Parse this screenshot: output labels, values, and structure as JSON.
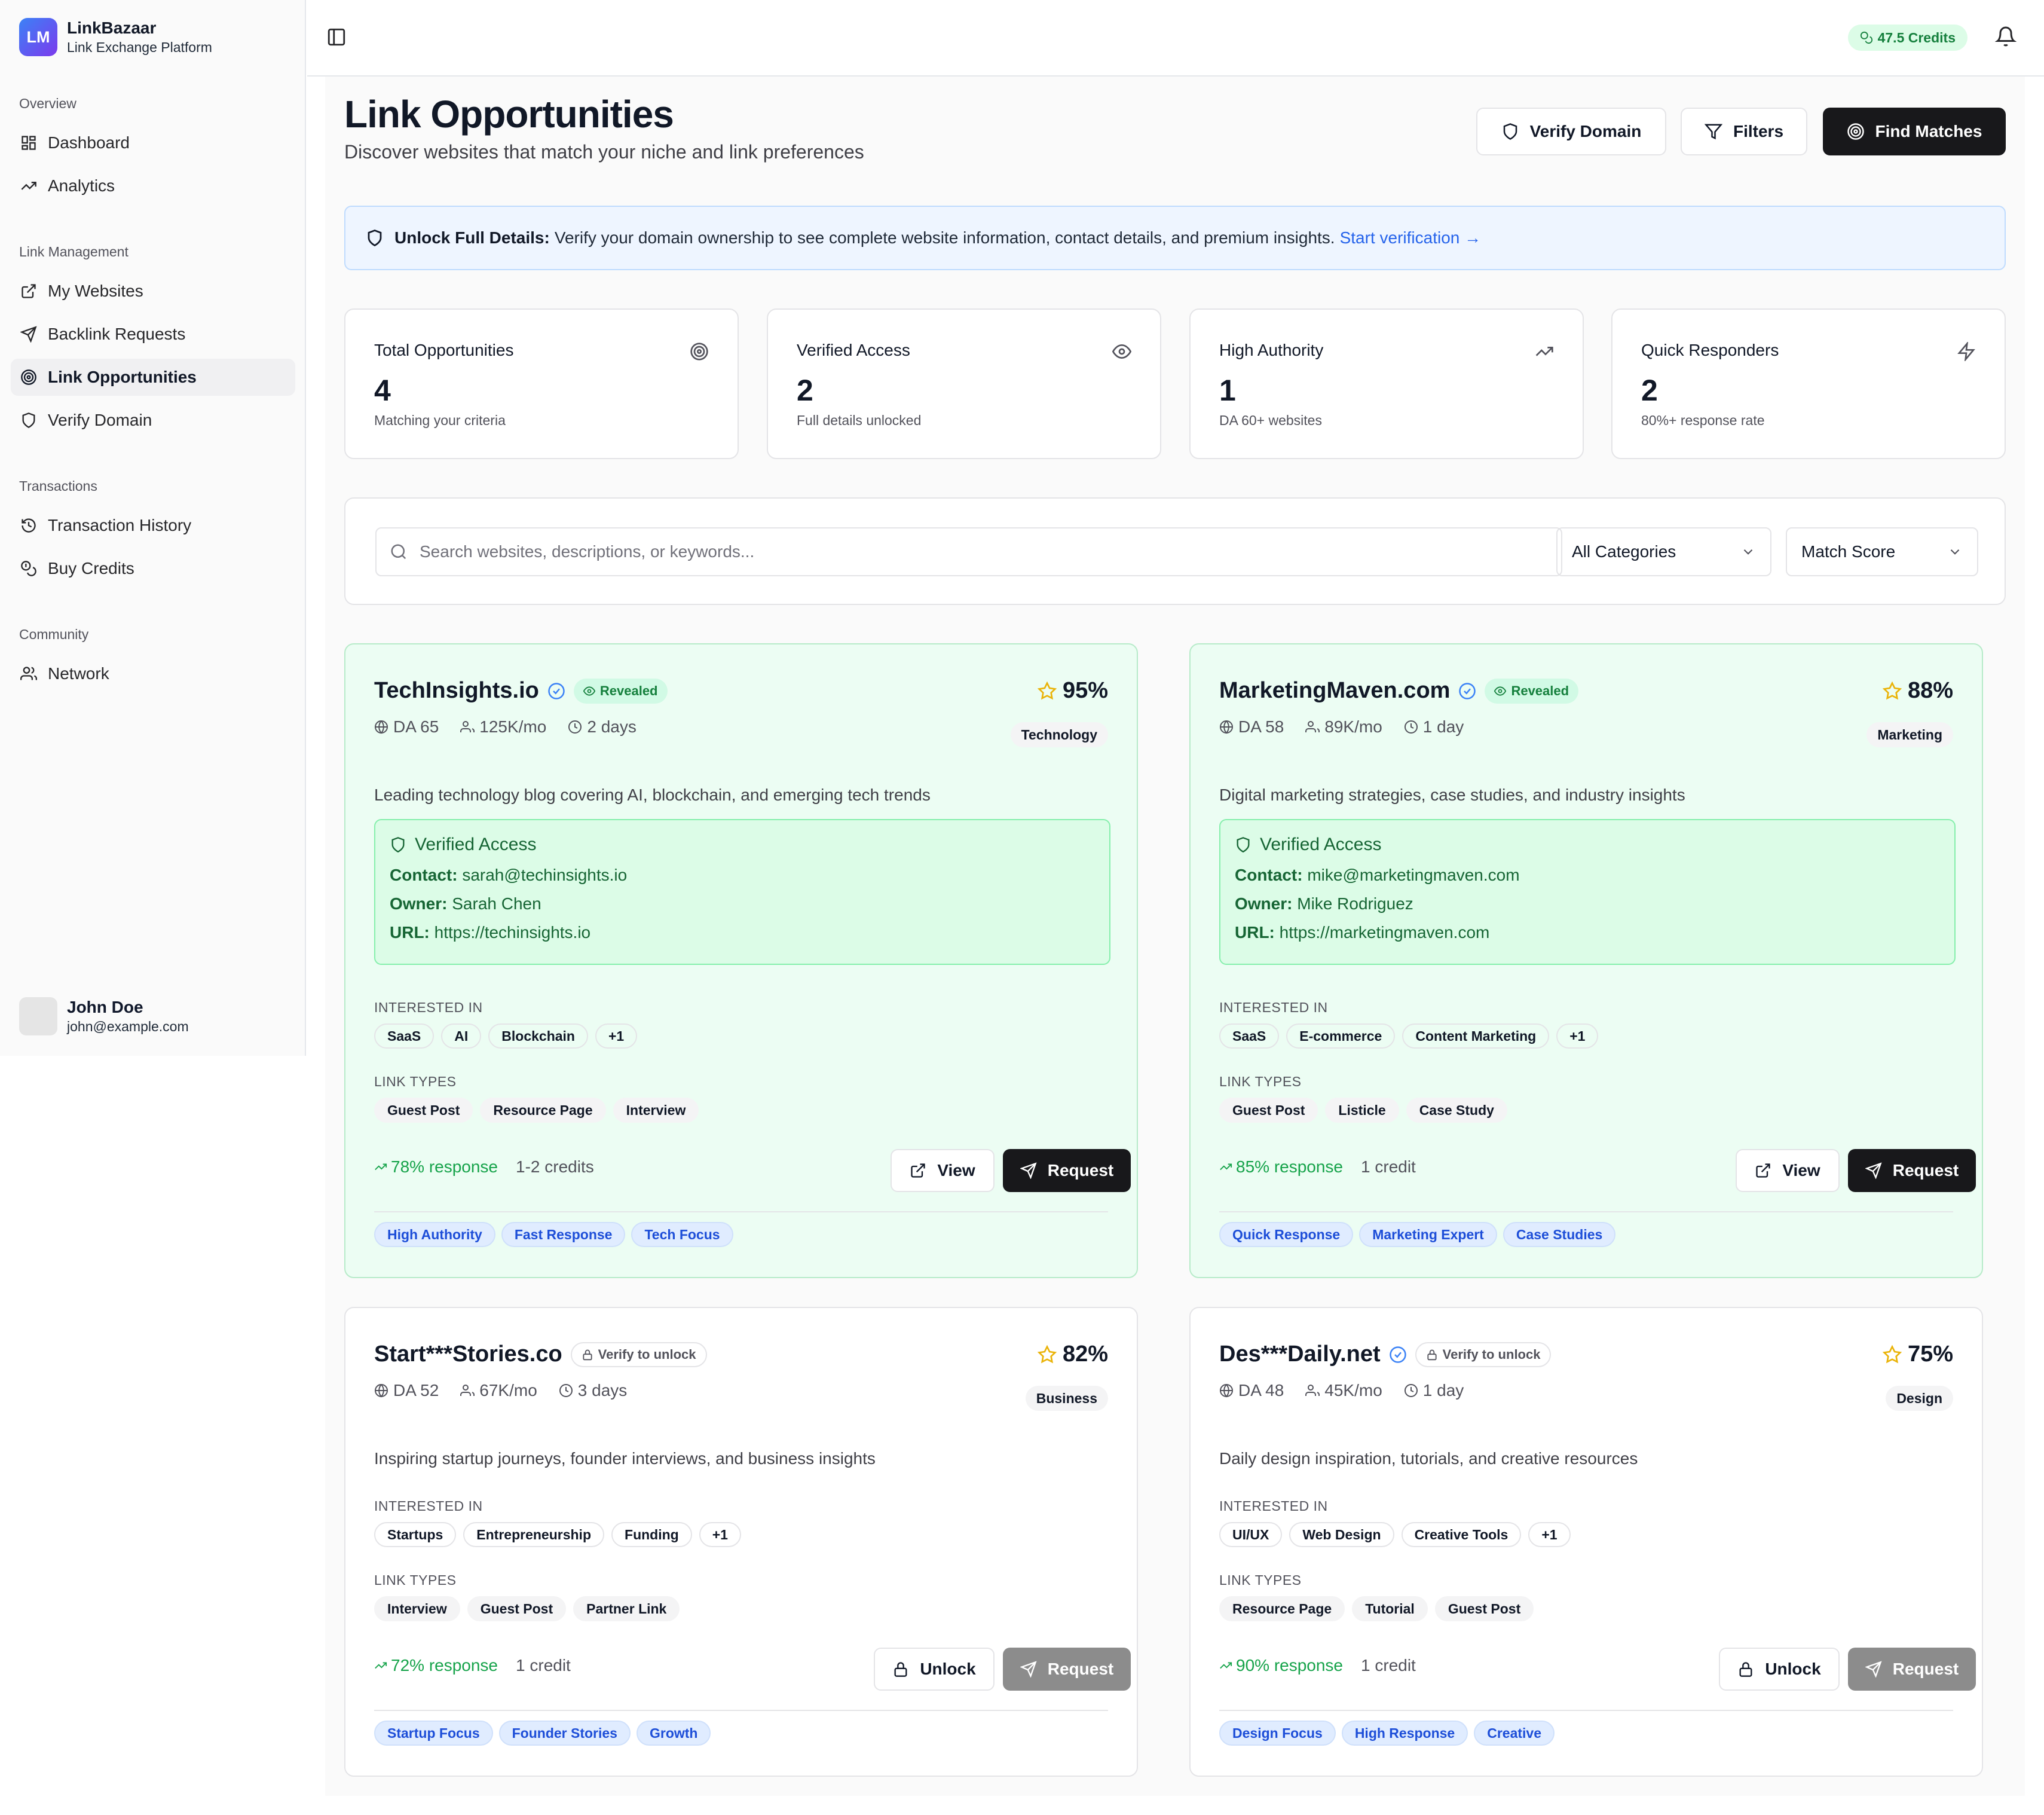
{
  "app": {
    "logo_initials": "LM",
    "name": "LinkBazaar",
    "subtitle": "Link Exchange Platform"
  },
  "sidebar": {
    "sections": [
      {
        "label": "Overview",
        "items": [
          {
            "label": "Dashboard",
            "icon": "grid-icon"
          },
          {
            "label": "Analytics",
            "icon": "trending-up-icon"
          }
        ]
      },
      {
        "label": "Link Management",
        "items": [
          {
            "label": "My Websites",
            "icon": "external-link-icon"
          },
          {
            "label": "Backlink Requests",
            "icon": "send-icon"
          },
          {
            "label": "Link Opportunities",
            "icon": "target-icon",
            "active": true
          },
          {
            "label": "Verify Domain",
            "icon": "shield-icon"
          }
        ]
      },
      {
        "label": "Transactions",
        "items": [
          {
            "label": "Transaction History",
            "icon": "history-icon"
          },
          {
            "label": "Buy Credits",
            "icon": "coins-icon"
          }
        ]
      },
      {
        "label": "Community",
        "items": [
          {
            "label": "Network",
            "icon": "users-icon"
          }
        ]
      }
    ],
    "user": {
      "name": "John Doe",
      "email": "john@example.com"
    }
  },
  "header": {
    "credits": "47.5 Credits"
  },
  "page": {
    "title": "Link Opportunities",
    "subtitle": "Discover websites that match your niche and link preferences",
    "actions": {
      "verify": "Verify Domain",
      "filters": "Filters",
      "find": "Find Matches"
    }
  },
  "banner": {
    "bold": "Unlock Full Details:",
    "text": "Verify your domain ownership to see complete website information, contact details, and premium insights.",
    "link": "Start verification →"
  },
  "stats": [
    {
      "label": "Total Opportunities",
      "value": "4",
      "sub": "Matching your criteria",
      "icon": "target-icon"
    },
    {
      "label": "Verified Access",
      "value": "2",
      "sub": "Full details unlocked",
      "icon": "eye-icon"
    },
    {
      "label": "High Authority",
      "value": "1",
      "sub": "DA 60+ websites",
      "icon": "trending-up-icon"
    },
    {
      "label": "Quick Responders",
      "value": "2",
      "sub": "80%+ response rate",
      "icon": "zap-icon"
    }
  ],
  "search": {
    "placeholder": "Search websites, descriptions, or keywords...",
    "category": "All Categories",
    "sort": "Match Score"
  },
  "labels": {
    "interested": "INTERESTED IN",
    "link_types": "LINK TYPES",
    "verified_access": "Verified Access",
    "contact": "Contact:",
    "owner": "Owner:",
    "url": "URL:",
    "view": "View",
    "request": "Request",
    "unlock": "Unlock",
    "revealed": "Revealed",
    "verify_unlock": "Verify to unlock"
  },
  "cards": [
    {
      "name": "TechInsights.io",
      "verified": true,
      "revealed": true,
      "score": "95%",
      "da": "DA 65",
      "traffic": "125K/mo",
      "time": "2 days",
      "category": "Technology",
      "desc": "Leading technology blog covering AI, blockchain, and emerging tech trends",
      "contact": "sarah@techinsights.io",
      "owner": "Sarah Chen",
      "url": "https://techinsights.io",
      "interests": [
        "SaaS",
        "AI",
        "Blockchain",
        "+1"
      ],
      "link_types": [
        "Guest Post",
        "Resource Page",
        "Interview"
      ],
      "response": "78% response",
      "cost": "1-2 credits",
      "tags": [
        "High Authority",
        "Fast Response",
        "Tech Focus"
      ]
    },
    {
      "name": "MarketingMaven.com",
      "verified": true,
      "revealed": true,
      "score": "88%",
      "da": "DA 58",
      "traffic": "89K/mo",
      "time": "1 day",
      "category": "Marketing",
      "desc": "Digital marketing strategies, case studies, and industry insights",
      "contact": "mike@marketingmaven.com",
      "owner": "Mike Rodriguez",
      "url": "https://marketingmaven.com",
      "interests": [
        "SaaS",
        "E-commerce",
        "Content Marketing",
        "+1"
      ],
      "link_types": [
        "Guest Post",
        "Listicle",
        "Case Study"
      ],
      "response": "85% response",
      "cost": "1 credit",
      "tags": [
        "Quick Response",
        "Marketing Expert",
        "Case Studies"
      ]
    },
    {
      "name": "Start***Stories.co",
      "verified": false,
      "revealed": false,
      "score": "82%",
      "da": "DA 52",
      "traffic": "67K/mo",
      "time": "3 days",
      "category": "Business",
      "desc": "Inspiring startup journeys, founder interviews, and business insights",
      "interests": [
        "Startups",
        "Entrepreneurship",
        "Funding",
        "+1"
      ],
      "link_types": [
        "Interview",
        "Guest Post",
        "Partner Link"
      ],
      "response": "72% response",
      "cost": "1 credit",
      "tags": [
        "Startup Focus",
        "Founder Stories",
        "Growth"
      ]
    },
    {
      "name": "Des***Daily.net",
      "verified": true,
      "revealed": false,
      "score": "75%",
      "da": "DA 48",
      "traffic": "45K/mo",
      "time": "1 day",
      "category": "Design",
      "desc": "Daily design inspiration, tutorials, and creative resources",
      "interests": [
        "UI/UX",
        "Web Design",
        "Creative Tools",
        "+1"
      ],
      "link_types": [
        "Resource Page",
        "Tutorial",
        "Guest Post"
      ],
      "response": "90% response",
      "cost": "1 credit",
      "tags": [
        "Design Focus",
        "High Response",
        "Creative"
      ]
    }
  ]
}
